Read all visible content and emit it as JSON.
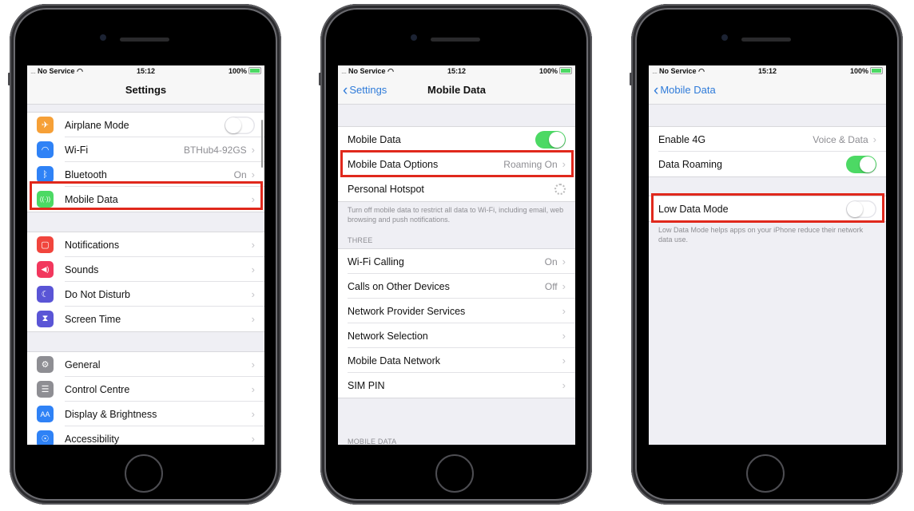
{
  "status_bar": {
    "carrier": "No Service",
    "time": "15:12",
    "battery": "100%"
  },
  "phones": [
    {
      "nav": {
        "title": "Settings"
      },
      "groups": [
        {
          "items": [
            {
              "label": "Airplane Mode",
              "icon": "airplane-icon",
              "glyph": "✈",
              "color": "#f6a037",
              "toggle": "off"
            },
            {
              "label": "Wi-Fi",
              "icon": "wifi-icon",
              "glyph": "◠",
              "color": "#2f82f6",
              "value": "BTHub4-92GS"
            },
            {
              "label": "Bluetooth",
              "icon": "bluetooth-icon",
              "glyph": "ᛒ",
              "color": "#2f82f6",
              "value": "On"
            },
            {
              "label": "Mobile Data",
              "icon": "antenna-icon",
              "glyph": "((·))",
              "color": "#4cd964",
              "highlighted": true
            }
          ]
        },
        {
          "items": [
            {
              "label": "Notifications",
              "icon": "notifications-icon",
              "glyph": "▢",
              "color": "#f1453d"
            },
            {
              "label": "Sounds",
              "icon": "speaker-icon",
              "glyph": "◀)",
              "color": "#f2375d"
            },
            {
              "label": "Do Not Disturb",
              "icon": "moon-icon",
              "glyph": "☾",
              "color": "#5a55d6"
            },
            {
              "label": "Screen Time",
              "icon": "hourglass-icon",
              "glyph": "⧗",
              "color": "#5a55d6"
            }
          ]
        },
        {
          "items": [
            {
              "label": "General",
              "icon": "gear-icon",
              "glyph": "⚙",
              "color": "#8e8e93"
            },
            {
              "label": "Control Centre",
              "icon": "switches-icon",
              "glyph": "☰",
              "color": "#8e8e93"
            },
            {
              "label": "Display & Brightness",
              "icon": "text-size-icon",
              "glyph": "AA",
              "color": "#2f82f6"
            },
            {
              "label": "Accessibility",
              "icon": "accessibility-icon",
              "glyph": "♿",
              "color": "#2f82f6"
            }
          ]
        }
      ]
    },
    {
      "nav": {
        "title": "Mobile Data",
        "back": "Settings"
      },
      "groups": [
        {
          "items": [
            {
              "label": "Mobile Data",
              "toggle": "on"
            },
            {
              "label": "Mobile Data Options",
              "value": "Roaming On",
              "highlighted": true
            },
            {
              "label": "Personal Hotspot",
              "spinner": true
            }
          ]
        },
        {
          "items": [
            {
              "label": "Wi-Fi Calling",
              "value": "On"
            },
            {
              "label": "Calls on Other Devices",
              "value": "Off"
            },
            {
              "label": "Network Provider Services"
            },
            {
              "label": "Network Selection"
            },
            {
              "label": "Mobile Data Network"
            },
            {
              "label": "SIM PIN"
            }
          ]
        }
      ],
      "footer": "Turn off mobile data to restrict all data to Wi-Fi, including email, web browsing and push notifications.",
      "section_header": "THREE",
      "bottom_header": "MOBILE DATA"
    },
    {
      "nav": {
        "back": "Mobile Data"
      },
      "groups": [
        {
          "items": [
            {
              "label": "Enable 4G",
              "value": "Voice & Data"
            },
            {
              "label": "Data Roaming",
              "toggle": "on"
            }
          ]
        },
        {
          "items": [
            {
              "label": "Low Data Mode",
              "toggle": "off",
              "highlighted": true
            }
          ]
        }
      ],
      "footer": "Low Data Mode helps apps on your iPhone reduce their network data use."
    }
  ],
  "chevron": "›",
  "back_chevron": "‹",
  "highlight_color": "#e0281c"
}
